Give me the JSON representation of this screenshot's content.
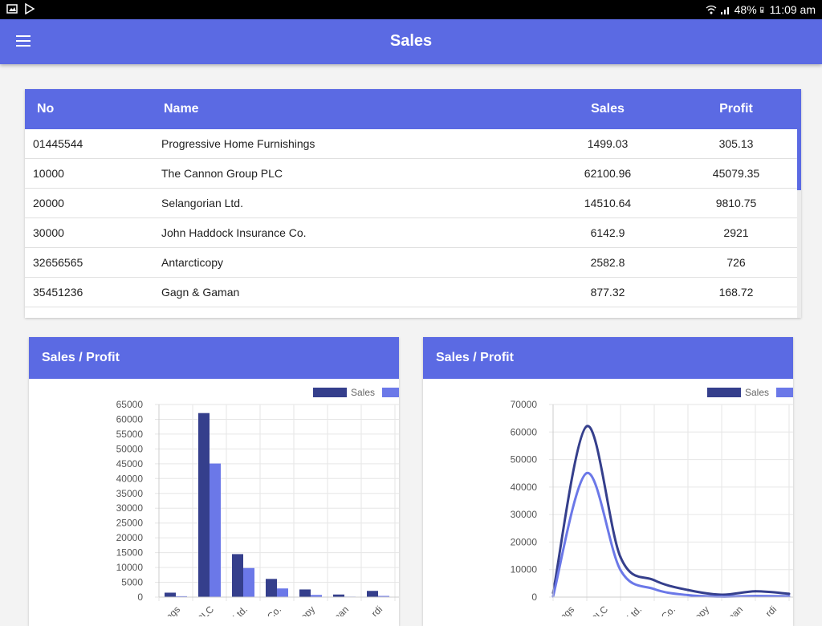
{
  "app": {
    "title": "Sales"
  },
  "statusbar": {
    "battery": "48%",
    "time": "11:09 am"
  },
  "table": {
    "headers": {
      "no": "No",
      "name": "Name",
      "sales": "Sales",
      "profit": "Profit"
    },
    "rows": [
      {
        "no": "01445544",
        "name": "Progressive Home Furnishings",
        "sales": "1499.03",
        "profit": "305.13"
      },
      {
        "no": "10000",
        "name": "The Cannon Group PLC",
        "sales": "62100.96",
        "profit": "45079.35"
      },
      {
        "no": "20000",
        "name": "Selangorian Ltd.",
        "sales": "14510.64",
        "profit": "9810.75"
      },
      {
        "no": "30000",
        "name": "John Haddock Insurance Co.",
        "sales": "6142.9",
        "profit": "2921"
      },
      {
        "no": "32656565",
        "name": "Antarcticopy",
        "sales": "2582.8",
        "profit": "726"
      },
      {
        "no": "35451236",
        "name": "Gagn & Gaman",
        "sales": "877.32",
        "profit": "168.72"
      }
    ]
  },
  "colors": {
    "primary": "#5b6ae3",
    "sales": "#353f8c",
    "profit": "#6b78e8"
  },
  "chart_data": [
    {
      "type": "bar",
      "title": "Sales / Profit",
      "categories": [
        "ings",
        "PLC",
        "Ltd.",
        "Co.",
        "copy",
        "man",
        "rdi"
      ],
      "series": [
        {
          "name": "Sales",
          "values": [
            1499,
            62101,
            14511,
            6143,
            2583,
            877,
            2100
          ]
        },
        {
          "name": "",
          "values": [
            305,
            45079,
            9811,
            2921,
            726,
            169,
            400
          ]
        }
      ],
      "ylim": [
        0,
        65000
      ],
      "yticks": [
        0,
        5000,
        10000,
        15000,
        20000,
        25000,
        30000,
        35000,
        40000,
        45000,
        50000,
        55000,
        60000,
        65000
      ],
      "grid": true,
      "legend": "top-right"
    },
    {
      "type": "line",
      "title": "Sales / Profit",
      "categories": [
        "ings",
        "PLC",
        "Ltd.",
        "Co.",
        "copy",
        "man",
        "rdi"
      ],
      "series": [
        {
          "name": "Sales",
          "values": [
            1499,
            62101,
            14511,
            6143,
            2583,
            877,
            2100,
            1200
          ]
        },
        {
          "name": "",
          "values": [
            305,
            45079,
            9811,
            2921,
            726,
            169,
            400,
            300
          ]
        }
      ],
      "ylim": [
        0,
        70000
      ],
      "yticks": [
        0,
        10000,
        20000,
        30000,
        40000,
        50000,
        60000,
        70000
      ],
      "grid": true,
      "legend": "top-right"
    }
  ]
}
